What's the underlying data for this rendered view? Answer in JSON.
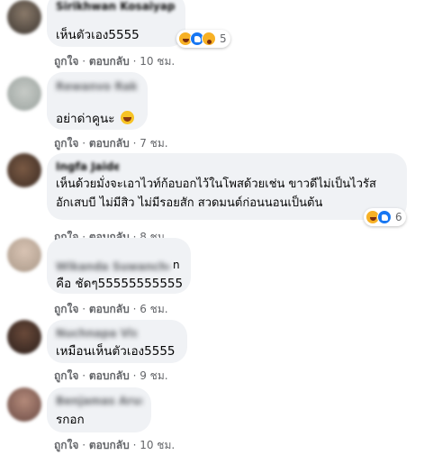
{
  "comments": [
    {
      "author": "Sirikhwan Kosaiyapath",
      "text": "เห็นตัวเอง5555",
      "like": "ถูกใจ",
      "reply": "ตอบกลับ",
      "time": "10 ชม.",
      "reactions": {
        "icons": [
          "haha-icon",
          "like-icon",
          "wow-icon"
        ],
        "count": "5"
      }
    },
    {
      "author": "Rewanvo Raksai",
      "text": "อย่าด่าคูนะ",
      "emoji": "laughing-emoji",
      "like": "ถูกใจ",
      "reply": "ตอบกลับ",
      "time": "7 ชม."
    },
    {
      "author": "Ingfa Jaidee",
      "text_line1": "เห็นด้วยมั่งจะเอาไวท์ก้อบอกไว้ในโพสด้วยเช่น ขาวดีไม่เป็นไวรัส",
      "text_line2": "อักเสบบี ไม่มีสิว ไม่มีรอยสัก สวดมนต์ก่อนนอนเป็นต้น",
      "like": "ถูกใจ",
      "reply": "ตอบกลับ",
      "time": "8 ชม.",
      "reactions": {
        "icons": [
          "haha-icon",
          "like-icon"
        ],
        "count": "6"
      }
    },
    {
      "author": "Wikanda Suwanchon",
      "author_line2": "n",
      "text": "คือ ชัดๆ55555555555",
      "like": "ถูกใจ",
      "reply": "ตอบกลับ",
      "time": "6 ชม."
    },
    {
      "author": "Nuchnapa Viset",
      "text": "เหมือนเห็นตัวเอง5555",
      "like": "ถูกใจ",
      "reply": "ตอบกลับ",
      "time": "9 ชม."
    },
    {
      "author": "Benjamas Arunsri",
      "text": "รกอก",
      "like": "ถูกใจ",
      "reply": "ตอบกลับ",
      "time": "10 ชม."
    }
  ],
  "separator": "·",
  "colors": {
    "bubble": "#f0f2f5",
    "meta": "#65676b",
    "text": "#050505",
    "like_blue": "#1877f2",
    "haha_yellow": "#f7b125"
  }
}
